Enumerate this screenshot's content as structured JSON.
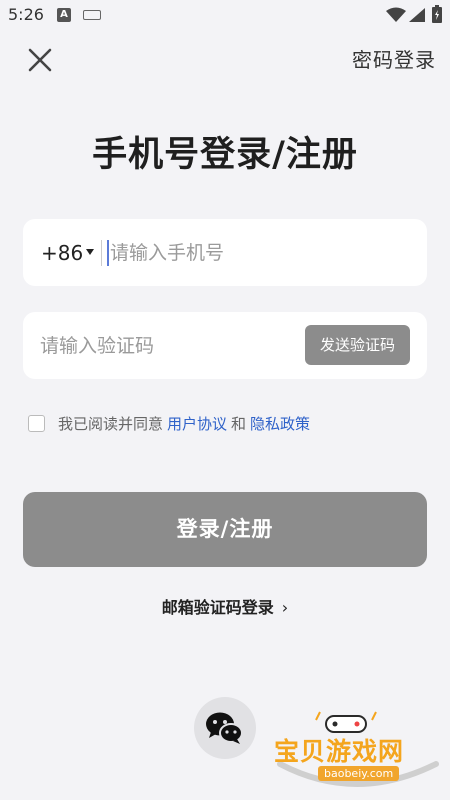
{
  "status_bar": {
    "time": "5:26",
    "a_icon_letter": "A"
  },
  "header": {
    "close_icon": "close-icon",
    "password_login": "密码登录"
  },
  "title": "手机号登录/注册",
  "phone": {
    "country_code": "+86",
    "placeholder": "请输入手机号",
    "value": ""
  },
  "code": {
    "placeholder": "请输入验证码",
    "value": "",
    "send_label": "发送验证码"
  },
  "agreement": {
    "checked": false,
    "prefix": "我已阅读并同意",
    "user_agreement": "用户协议",
    "and": "和",
    "privacy_policy": "隐私政策"
  },
  "login_button": "登录/注册",
  "email_login": "邮箱验证码登录",
  "social": {
    "wechat_icon": "wechat-icon"
  },
  "watermark": {
    "text": "宝贝游戏网",
    "url": "baobeiy.com"
  },
  "colors": {
    "background": "#f3f3f6",
    "link": "#2f62c9",
    "button_disabled": "#8c8c8c",
    "watermark": "#f4a51d"
  }
}
